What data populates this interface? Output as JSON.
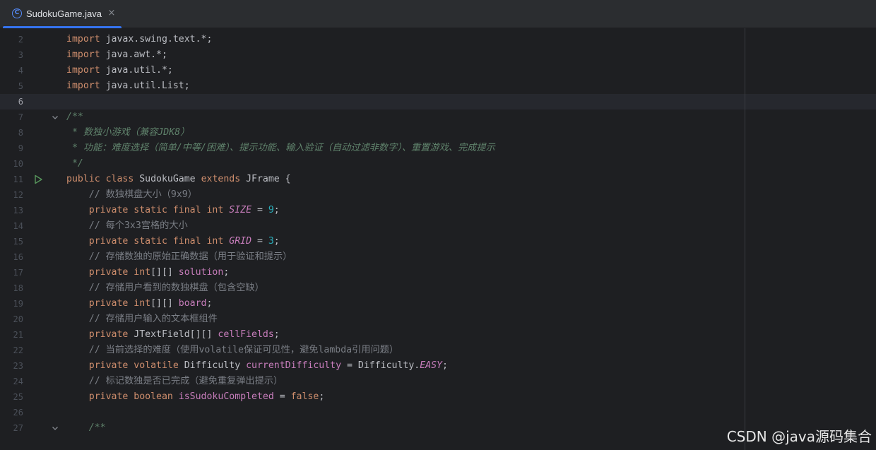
{
  "tab": {
    "title": "SudokuGame.java",
    "icon": "java-class-icon",
    "close_glyph": "×"
  },
  "colors": {
    "background": "#1e1f22",
    "tab_bar": "#2b2d30",
    "accent": "#3574f0",
    "keyword": "#cf8e6d",
    "field": "#c77dbb",
    "number": "#2aacb8",
    "comment": "#7a7e85",
    "doc_comment": "#5f826b"
  },
  "editor": {
    "current_line": 6,
    "lines": [
      {
        "num": "2",
        "tokens": [
          {
            "t": "import ",
            "c": "kw"
          },
          {
            "t": "javax.swing.text.*;",
            "c": "plain"
          }
        ]
      },
      {
        "num": "3",
        "tokens": [
          {
            "t": "import ",
            "c": "kw"
          },
          {
            "t": "java.awt.*;",
            "c": "plain"
          }
        ]
      },
      {
        "num": "4",
        "tokens": [
          {
            "t": "import ",
            "c": "kw"
          },
          {
            "t": "java.util.*;",
            "c": "plain"
          }
        ]
      },
      {
        "num": "5",
        "tokens": [
          {
            "t": "import ",
            "c": "kw"
          },
          {
            "t": "java.util.List;",
            "c": "plain"
          }
        ]
      },
      {
        "num": "6",
        "tokens": []
      },
      {
        "num": "7",
        "gutter": "fold-icon",
        "tokens": [
          {
            "t": "/**",
            "c": "doc"
          }
        ]
      },
      {
        "num": "8",
        "tokens": [
          {
            "t": " * 数独小游戏（兼容JDK8）",
            "c": "doc"
          }
        ]
      },
      {
        "num": "9",
        "tokens": [
          {
            "t": " * 功能：难度选择（简单/中等/困难）、提示功能、输入验证（自动过滤非数字）、重置游戏、完成提示",
            "c": "doc"
          }
        ]
      },
      {
        "num": "10",
        "tokens": [
          {
            "t": " */",
            "c": "doc"
          }
        ]
      },
      {
        "num": "11",
        "gutter": "run-icon",
        "tokens": [
          {
            "t": "public class ",
            "c": "kw"
          },
          {
            "t": "SudokuGame ",
            "c": "plain"
          },
          {
            "t": "extends ",
            "c": "kw"
          },
          {
            "t": "JFrame {",
            "c": "plain"
          }
        ]
      },
      {
        "num": "12",
        "tokens": [
          {
            "t": "    // 数独棋盘大小（9x9）",
            "c": "comment"
          }
        ]
      },
      {
        "num": "13",
        "tokens": [
          {
            "t": "    private static final int ",
            "c": "kw"
          },
          {
            "t": "SIZE",
            "c": "static"
          },
          {
            "t": " = ",
            "c": "plain"
          },
          {
            "t": "9",
            "c": "num"
          },
          {
            "t": ";",
            "c": "plain"
          }
        ]
      },
      {
        "num": "14",
        "tokens": [
          {
            "t": "    // 每个3x3宫格的大小",
            "c": "comment"
          }
        ]
      },
      {
        "num": "15",
        "tokens": [
          {
            "t": "    private static final int ",
            "c": "kw"
          },
          {
            "t": "GRID",
            "c": "static"
          },
          {
            "t": " = ",
            "c": "plain"
          },
          {
            "t": "3",
            "c": "num"
          },
          {
            "t": ";",
            "c": "plain"
          }
        ]
      },
      {
        "num": "16",
        "tokens": [
          {
            "t": "    // 存储数独的原始正确数据（用于验证和提示）",
            "c": "comment"
          }
        ]
      },
      {
        "num": "17",
        "tokens": [
          {
            "t": "    private int",
            "c": "kw"
          },
          {
            "t": "[][] ",
            "c": "plain"
          },
          {
            "t": "solution",
            "c": "field"
          },
          {
            "t": ";",
            "c": "plain"
          }
        ]
      },
      {
        "num": "18",
        "tokens": [
          {
            "t": "    // 存储用户看到的数独棋盘（包含空缺）",
            "c": "comment"
          }
        ]
      },
      {
        "num": "19",
        "tokens": [
          {
            "t": "    private int",
            "c": "kw"
          },
          {
            "t": "[][] ",
            "c": "plain"
          },
          {
            "t": "board",
            "c": "field"
          },
          {
            "t": ";",
            "c": "plain"
          }
        ]
      },
      {
        "num": "20",
        "tokens": [
          {
            "t": "    // 存储用户输入的文本框组件",
            "c": "comment"
          }
        ]
      },
      {
        "num": "21",
        "tokens": [
          {
            "t": "    private ",
            "c": "kw"
          },
          {
            "t": "JTextField[][] ",
            "c": "plain"
          },
          {
            "t": "cellFields",
            "c": "field"
          },
          {
            "t": ";",
            "c": "plain"
          }
        ]
      },
      {
        "num": "22",
        "tokens": [
          {
            "t": "    // 当前选择的难度（使用volatile保证可见性，避免lambda引用问题）",
            "c": "comment"
          }
        ]
      },
      {
        "num": "23",
        "tokens": [
          {
            "t": "    private volatile ",
            "c": "kw"
          },
          {
            "t": "Difficulty ",
            "c": "plain"
          },
          {
            "t": "currentDifficulty",
            "c": "field"
          },
          {
            "t": " = Difficulty.",
            "c": "plain"
          },
          {
            "t": "EASY",
            "c": "static"
          },
          {
            "t": ";",
            "c": "plain"
          }
        ]
      },
      {
        "num": "24",
        "tokens": [
          {
            "t": "    // 标记数独是否已完成（避免重复弹出提示）",
            "c": "comment"
          }
        ]
      },
      {
        "num": "25",
        "tokens": [
          {
            "t": "    private boolean ",
            "c": "kw"
          },
          {
            "t": "isSudokuCompleted",
            "c": "field"
          },
          {
            "t": " = ",
            "c": "plain"
          },
          {
            "t": "false",
            "c": "kw"
          },
          {
            "t": ";",
            "c": "plain"
          }
        ]
      },
      {
        "num": "26",
        "tokens": []
      },
      {
        "num": "27",
        "gutter": "fold-icon",
        "tokens": [
          {
            "t": "    /**",
            "c": "doc"
          }
        ]
      }
    ]
  },
  "watermark": "CSDN @java源码集合"
}
